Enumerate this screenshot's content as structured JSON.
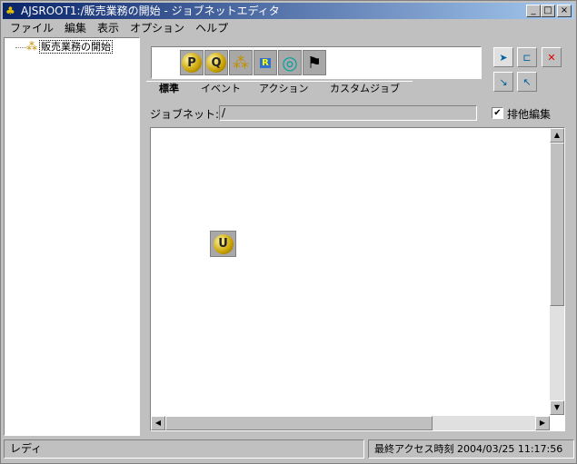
{
  "window": {
    "title": "AJSROOT1:/販売業務の開始 - ジョブネットエディタ",
    "minimize": "_",
    "maximize": "□",
    "close": "×"
  },
  "menu": [
    "ファイル",
    "編集",
    "表示",
    "オプション",
    "ヘルプ"
  ],
  "tree": {
    "root_label": "販売業務の開始"
  },
  "palette": {
    "icons": [
      {
        "name": "p-icon",
        "glyph": "P"
      },
      {
        "name": "q-icon",
        "glyph": "Q"
      },
      {
        "name": "jobnet-icon",
        "glyph": "⁂"
      },
      {
        "name": "remote-jobnet-icon",
        "glyph": "R"
      },
      {
        "name": "judgment-icon",
        "glyph": "◎"
      },
      {
        "name": "flag-icon",
        "glyph": "⚑"
      }
    ]
  },
  "tabs": [
    "標準",
    "イベント",
    "アクション",
    "カスタムジョブ"
  ],
  "active_tab": "標準",
  "jobnet": {
    "label": "ジョブネット:",
    "value": "/"
  },
  "exclusive_edit": {
    "label": "排他編集",
    "checked": true
  },
  "canvas": {
    "unit_icon_glyph": "U"
  },
  "status": {
    "left": "レディ",
    "right": "最終アクセス時刻 2004/03/25 11:17:56"
  }
}
